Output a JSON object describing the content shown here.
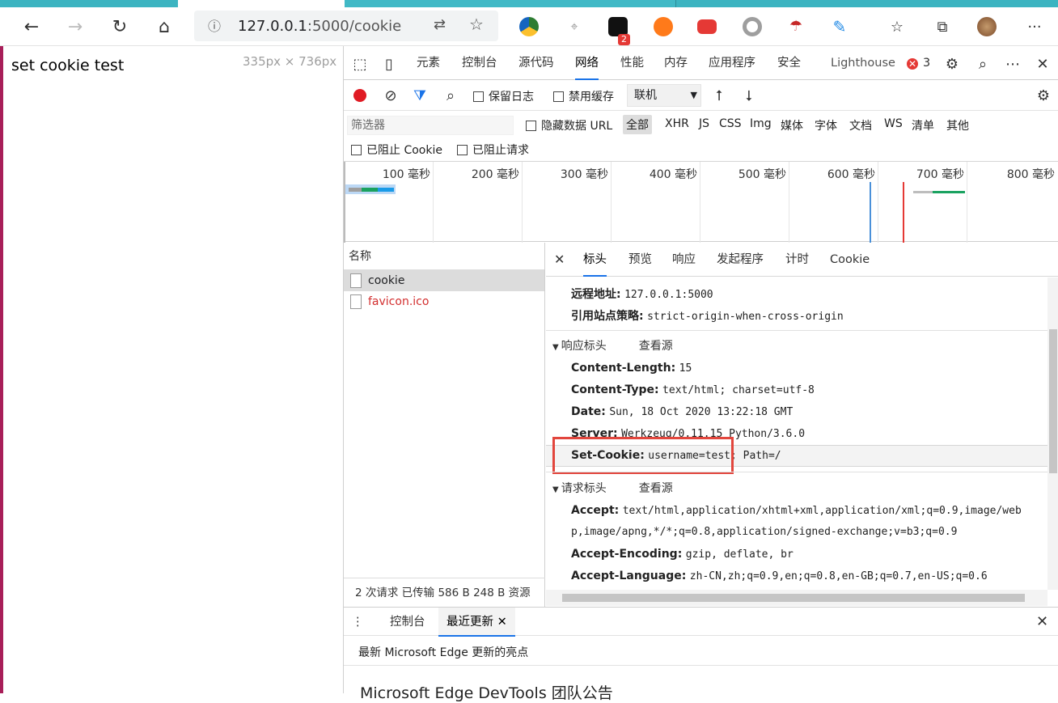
{
  "browser": {
    "url_host": "127.0.0.1",
    "url_path": ":5000/cookie",
    "icons": {
      "back": "back-arrow-icon",
      "forward": "forward-arrow-icon",
      "refresh": "refresh-icon",
      "home": "home-icon"
    },
    "extension_badge": "2"
  },
  "page": {
    "heading": "set cookie test",
    "viewport_size": "335px × 736px"
  },
  "devtools": {
    "tabs": [
      "元素",
      "控制台",
      "源代码",
      "网络",
      "性能",
      "内存",
      "应用程序",
      "安全",
      "Lighthouse"
    ],
    "active_tab": "网络",
    "error_count": "3",
    "net_toolbar": {
      "preserve_log": "保留日志",
      "disable_cache": "禁用缓存",
      "throttle": "联机"
    },
    "filter": {
      "placeholder": "筛选器",
      "hide_data_url": "隐藏数据 URL",
      "types": [
        "全部",
        "XHR",
        "JS",
        "CSS",
        "Img",
        "媒体",
        "字体",
        "文档",
        "WS",
        "清单",
        "其他"
      ],
      "active_type": "全部",
      "blocked_cookies": "已阻止 Cookie",
      "blocked_requests": "已阻止请求"
    },
    "overview_ticks": [
      "100 毫秒",
      "200 毫秒",
      "300 毫秒",
      "400 毫秒",
      "500 毫秒",
      "600 毫秒",
      "700 毫秒",
      "800 毫秒"
    ],
    "request_list": {
      "header": "名称",
      "rows": [
        {
          "name": "cookie",
          "error": false
        },
        {
          "name": "favicon.ico",
          "error": true
        }
      ],
      "summary": "2 次请求  已传输 586 B  248 B 资源"
    },
    "detail": {
      "tabs": [
        "标头",
        "预览",
        "响应",
        "发起程序",
        "计时",
        "Cookie"
      ],
      "active_tab": "标头",
      "general": [
        {
          "key": "远程地址:",
          "value": "127.0.0.1:5000"
        },
        {
          "key": "引用站点策略:",
          "value": "strict-origin-when-cross-origin"
        }
      ],
      "response_section": "响应标头",
      "view_source": "查看源",
      "response_headers": [
        {
          "key": "Content-Length:",
          "value": "15"
        },
        {
          "key": "Content-Type:",
          "value": "text/html; charset=utf-8"
        },
        {
          "key": "Date:",
          "value": "Sun, 18 Oct 2020 13:22:18 GMT"
        },
        {
          "key": "Server:",
          "value": "Werkzeug/0.11.15 Python/3.6.0"
        },
        {
          "key": "Set-Cookie:",
          "value": "username=test; Path=/"
        }
      ],
      "request_section": "请求标头",
      "request_headers": [
        {
          "key": "Accept:",
          "value": "text/html,application/xhtml+xml,application/xml;q=0.9,image/web"
        },
        {
          "key": "",
          "value": "p,image/apng,*/*;q=0.8,application/signed-exchange;v=b3;q=0.9"
        },
        {
          "key": "Accept-Encoding:",
          "value": "gzip, deflate, br"
        },
        {
          "key": "Accept-Language:",
          "value": "zh-CN,zh;q=0.9,en;q=0.8,en-GB;q=0.7,en-US;q=0.6"
        }
      ]
    },
    "drawer": {
      "tabs": [
        "控制台",
        "最近更新"
      ],
      "active_tab": "最近更新",
      "headline": "最新 Microsoft Edge 更新的亮点",
      "article_title": "Microsoft Edge DevTools 团队公告"
    }
  }
}
